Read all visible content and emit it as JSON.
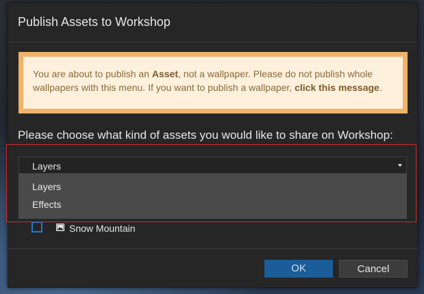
{
  "dialog": {
    "title": "Publish Assets to Workshop"
  },
  "notice": {
    "text_before_asset": "You are about to publish an ",
    "asset_word": "Asset",
    "text_middle": ", not a wallpaper. Please do not publish whole wallpapers with this menu. If you want to publish a wallpaper, ",
    "link_text": "click this message",
    "text_end": "."
  },
  "prompt": "Please choose what kind of assets you would like to share on Workshop:",
  "asset_type_select": {
    "selected": "Layers",
    "options": [
      "Layers",
      "Effects"
    ],
    "icon": "caret-down-icon"
  },
  "assets": [
    {
      "name": "Snow Mountain",
      "checked": false,
      "icon": "image-icon"
    }
  ],
  "buttons": {
    "ok": "OK",
    "cancel": "Cancel"
  },
  "colors": {
    "accent": "#1d7ad6",
    "ok_button": "#1a5d98",
    "notice_border": "#f0b36a",
    "notice_background": "#fdf0dd",
    "highlight": "#d22a2a"
  }
}
